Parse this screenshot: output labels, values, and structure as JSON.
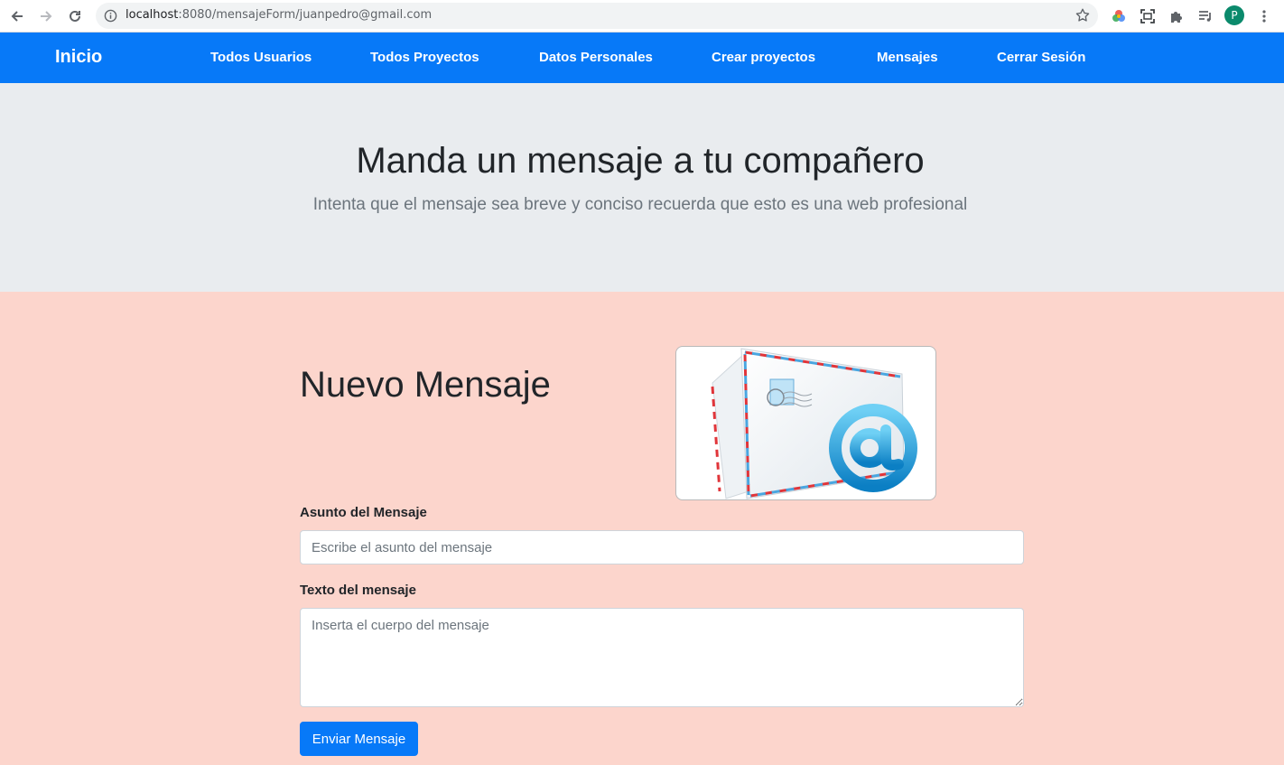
{
  "browser": {
    "url_host": "localhost",
    "url_path": ":8080/mensajeForm/juanpedro@gmail.com",
    "profile_initial": "P"
  },
  "navbar": {
    "brand": "Inicio",
    "links": [
      "Todos Usuarios",
      "Todos Proyectos",
      "Datos Personales",
      "Crear proyectos",
      "Mensajes",
      "Cerrar Sesión"
    ],
    "color": "#0779f8"
  },
  "jumbotron": {
    "title": "Manda un mensaje a tu compañero",
    "subtitle": "Intenta que el mensaje sea breve y conciso recuerda que esto es una web profesional"
  },
  "form": {
    "title": "Nuevo Mensaje",
    "subject_label": "Asunto del Mensaje",
    "subject_placeholder": "Escribe el asunto del mensaje",
    "body_label": "Texto del mensaje",
    "body_placeholder": "Inserta el cuerpo del mensaje",
    "submit_label": "Enviar Mensaje",
    "image": "email-envelope-at-icon"
  },
  "colors": {
    "page_background": "#fcd5cc",
    "jumbotron_background": "#e9ecef",
    "primary": "#0779f8"
  }
}
